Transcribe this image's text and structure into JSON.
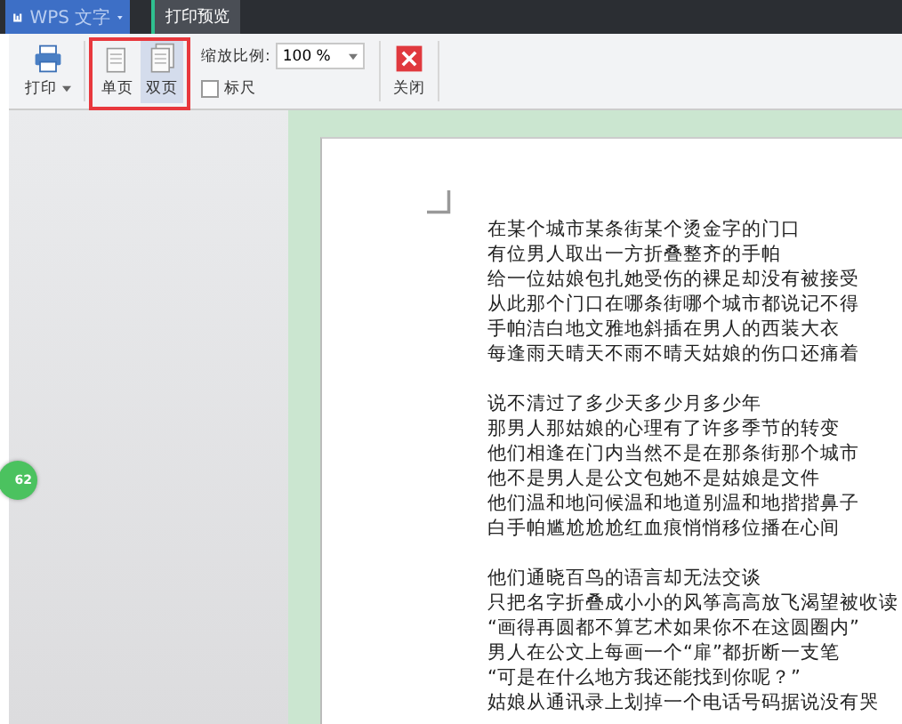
{
  "app": {
    "title": "WPS 文字"
  },
  "tabs": [
    {
      "label": "打印预览",
      "selected": true
    }
  ],
  "toolbar": {
    "print": "打印",
    "view_modes": [
      {
        "label": "单页",
        "selected": false
      },
      {
        "label": "双页",
        "selected": true
      }
    ],
    "zoom": {
      "label": "缩放比例:",
      "value": "100 %"
    },
    "ruler": {
      "label": "标尺",
      "checked": false
    },
    "close": "关闭"
  },
  "badge": "62",
  "document": {
    "stanzas": [
      [
        "在某个城市某条街某个烫金字的门口",
        "有位男人取出一方折叠整齐的手帕",
        "给一位姑娘包扎她受伤的裸足却没有被接受",
        "从此那个门口在哪条街哪个城市都说记不得",
        "手帕洁白地文雅地斜插在男人的西装大衣",
        "每逢雨天晴天不雨不晴天姑娘的伤口还痛着"
      ],
      [
        "说不清过了多少天多少月多少年",
        "那男人那姑娘的心理有了许多季节的转变",
        "他们相逢在门内当然不是在那条街那个城市",
        "他不是男人是公文包她不是姑娘是文件",
        "他们温和地问候温和地道别温和地揩揩鼻子",
        "白手帕尴尬尬尬红血痕悄悄移位播在心间"
      ],
      [
        "他们通晓百鸟的语言却无法交谈",
        "只把名字折叠成小小的风筝高高放飞渴望被收读",
        "“画得再圆都不算艺术如果你不在这圆圈内”",
        "男人在公文上每画一个“扉”都折断一支笔",
        "“可是在什么地方我还能找到你呢？”",
        "姑娘从通讯录上划掉一个电话号码据说没有哭"
      ]
    ]
  }
}
